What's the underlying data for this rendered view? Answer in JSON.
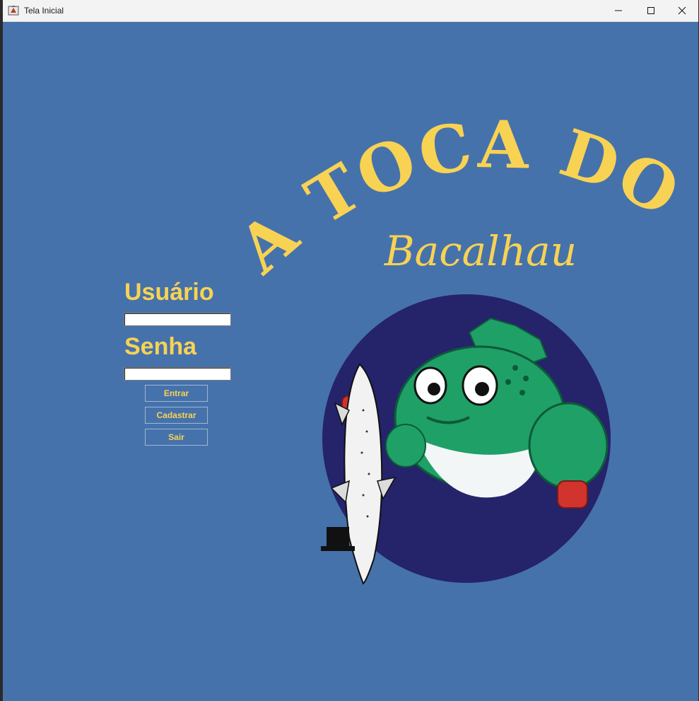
{
  "window": {
    "title": "Tela Inicial",
    "app_icon": "java-app-icon",
    "controls": [
      "minimize-icon",
      "maximize-icon",
      "close-icon"
    ]
  },
  "login": {
    "user_label": "Usuário",
    "user_value": "",
    "password_label": "Senha",
    "password_value": "",
    "buttons": {
      "login": "Entrar",
      "register": "Cadastrar",
      "exit": "Sair"
    }
  },
  "logo": {
    "headline": "A TOCA DO",
    "script": "Bacalhau"
  },
  "colors": {
    "background": "#4672ab",
    "accent": "#f8d253",
    "circle": "#25236a",
    "fish": "#1fa067"
  }
}
